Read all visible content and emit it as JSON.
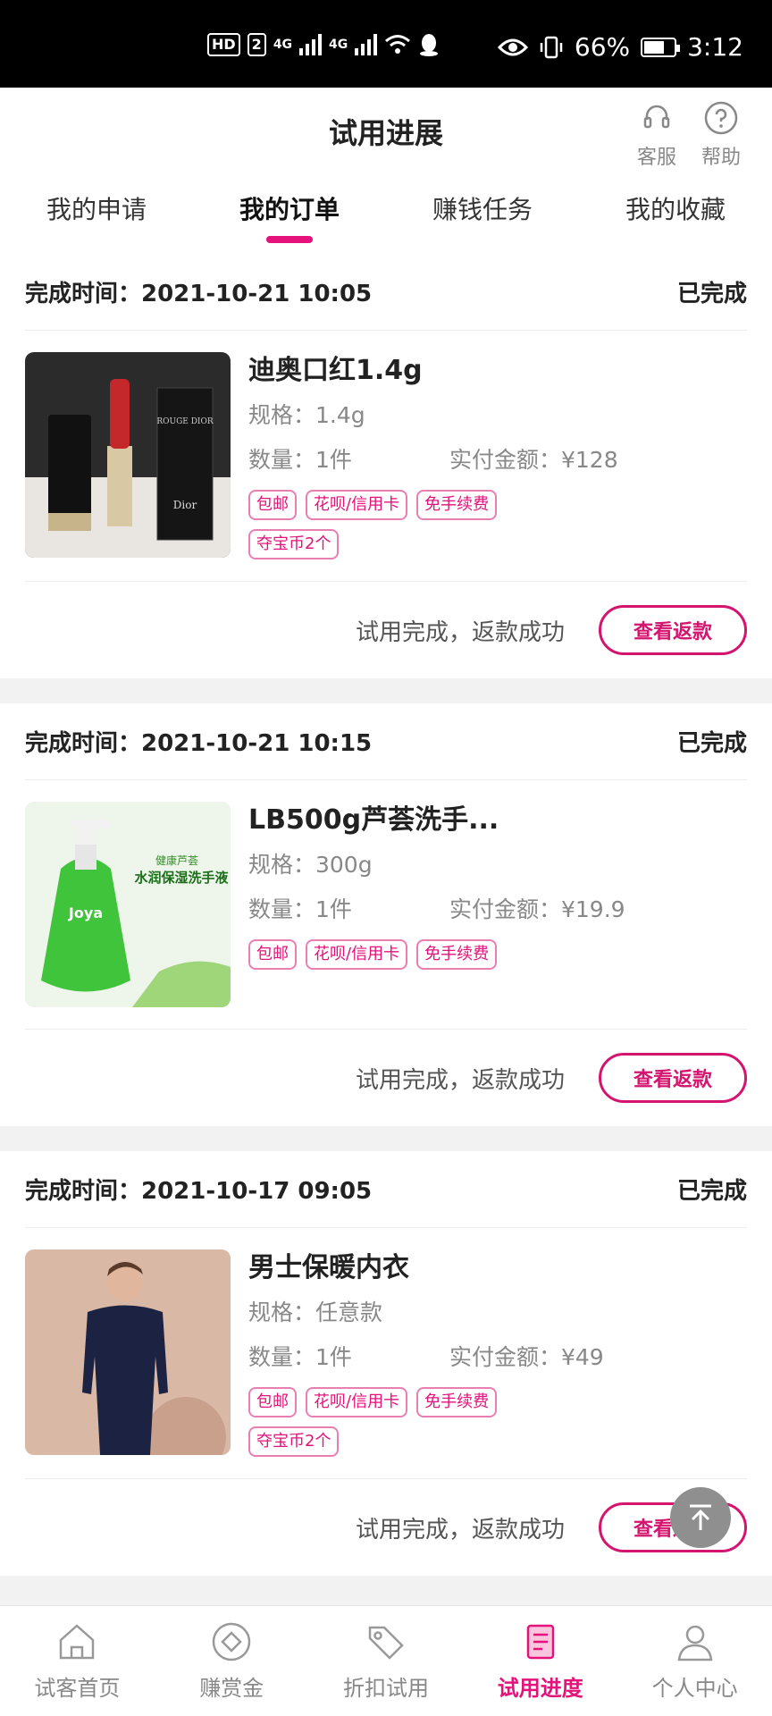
{
  "status_bar": {
    "network1": "4G",
    "network2": "4G",
    "battery": "66%",
    "time": "3:12",
    "hd": "HD",
    "sim": "2"
  },
  "header": {
    "title": "试用进展",
    "service_label": "客服",
    "help_label": "帮助"
  },
  "tabs": [
    {
      "label": "我的申请"
    },
    {
      "label": "我的订单"
    },
    {
      "label": "赚钱任务"
    },
    {
      "label": "我的收藏"
    }
  ],
  "active_tab": "我的订单",
  "orders": [
    {
      "time_label": "完成时间：2021-10-21 10:05",
      "status": "已完成",
      "name": "迪奥口红1.4g",
      "spec": "规格：1.4g",
      "qty": "数量：1件",
      "paid": "实付金额：¥128",
      "tags": [
        "包邮",
        "花呗/信用卡",
        "免手续费",
        "夺宝币2个"
      ],
      "result": "试用完成，返款成功",
      "action": "查看返款",
      "image_text": {
        "box_brand": "ROUGE DIOR",
        "box_logo": "Dior"
      }
    },
    {
      "time_label": "完成时间：2021-10-21 10:15",
      "status": "已完成",
      "name": "LB500g芦荟洗手...",
      "spec": "规格：300g",
      "qty": "数量：1件",
      "paid": "实付金额：¥19.9",
      "tags": [
        "包邮",
        "花呗/信用卡",
        "免手续费"
      ],
      "result": "试用完成，返款成功",
      "action": "查看返款",
      "image_text": {
        "line1": "健康芦荟",
        "line2": "水润保湿洗手液",
        "brand": "Joya"
      }
    },
    {
      "time_label": "完成时间：2021-10-17 09:05",
      "status": "已完成",
      "name": "男士保暖内衣",
      "spec": "规格：任意款",
      "qty": "数量：1件",
      "paid": "实付金额：¥49",
      "tags": [
        "包邮",
        "花呗/信用卡",
        "免手续费",
        "夺宝币2个"
      ],
      "result": "试用完成，返款成功",
      "action": "查看返款"
    }
  ],
  "bottom_nav": [
    {
      "label": "试客首页",
      "icon": "home-icon"
    },
    {
      "label": "赚赏金",
      "icon": "diamond-icon"
    },
    {
      "label": "折扣试用",
      "icon": "tag-icon"
    },
    {
      "label": "试用进度",
      "icon": "document-icon"
    },
    {
      "label": "个人中心",
      "icon": "user-icon"
    }
  ],
  "colors": {
    "accent": "#e4127a",
    "tag_border": "#e87fb1",
    "back_top": "#8f8f8f"
  }
}
